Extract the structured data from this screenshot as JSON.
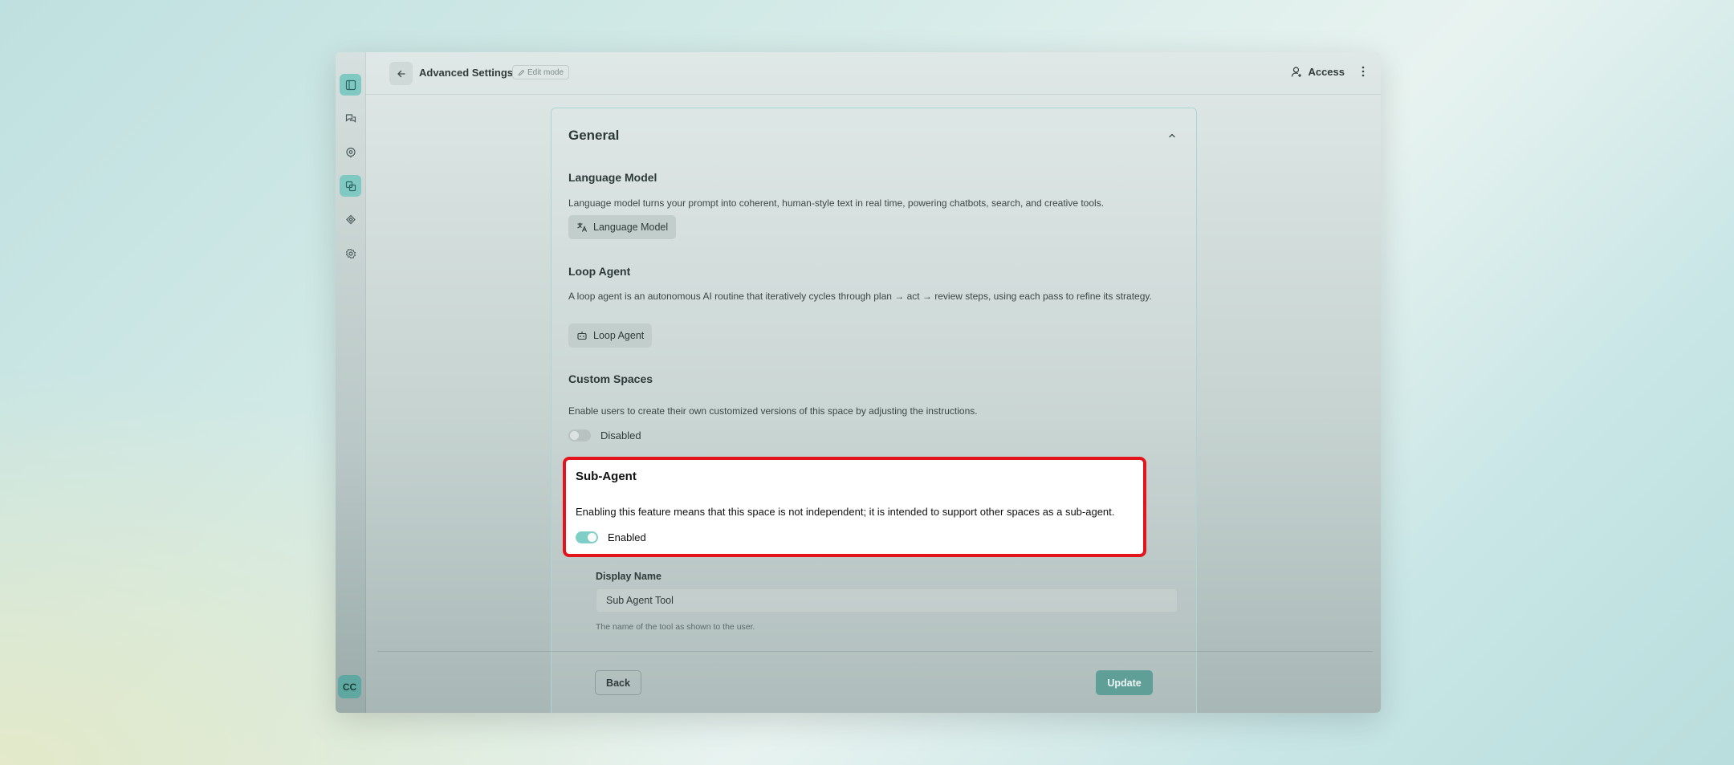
{
  "header": {
    "title": "Advanced Settings",
    "edit_badge": "Edit mode",
    "access_label": "Access"
  },
  "sidebar": {
    "items": [
      {
        "icon": "panel-icon",
        "active": true
      },
      {
        "icon": "chat-icon",
        "active": false
      },
      {
        "icon": "bot-icon",
        "active": false
      },
      {
        "icon": "spaces-icon",
        "active": true
      },
      {
        "icon": "diamond-icon",
        "active": false
      },
      {
        "icon": "gear-icon",
        "active": false
      }
    ],
    "avatar_initials": "CC"
  },
  "card": {
    "title": "General",
    "language_model": {
      "title": "Language Model",
      "description": "Language model turns your prompt into coherent, human-style text in real time, powering chatbots, search, and creative tools.",
      "button": "Language Model"
    },
    "loop_agent": {
      "title": "Loop Agent",
      "description": "A loop agent is an autonomous AI routine that iteratively cycles through plan → act → review steps, using each pass to refine its strategy.",
      "button": "Loop Agent"
    },
    "custom_spaces": {
      "title": "Custom Spaces",
      "description": "Enable users to create their own customized versions of this space by adjusting the instructions.",
      "toggle_label": "Disabled",
      "enabled": false
    },
    "sub_agent": {
      "title": "Sub-Agent",
      "description": "Enabling this feature means that this space is not independent; it is intended to support other spaces as a sub-agent.",
      "toggle_label": "Enabled",
      "enabled": true
    },
    "display_name": {
      "label": "Display Name",
      "value": "Sub Agent Tool",
      "help": "The name of the tool as shown to the user."
    }
  },
  "footer": {
    "back_label": "Back",
    "update_label": "Update"
  },
  "colors": {
    "accent": "#5f9f97",
    "highlight_border": "#e3141b"
  }
}
